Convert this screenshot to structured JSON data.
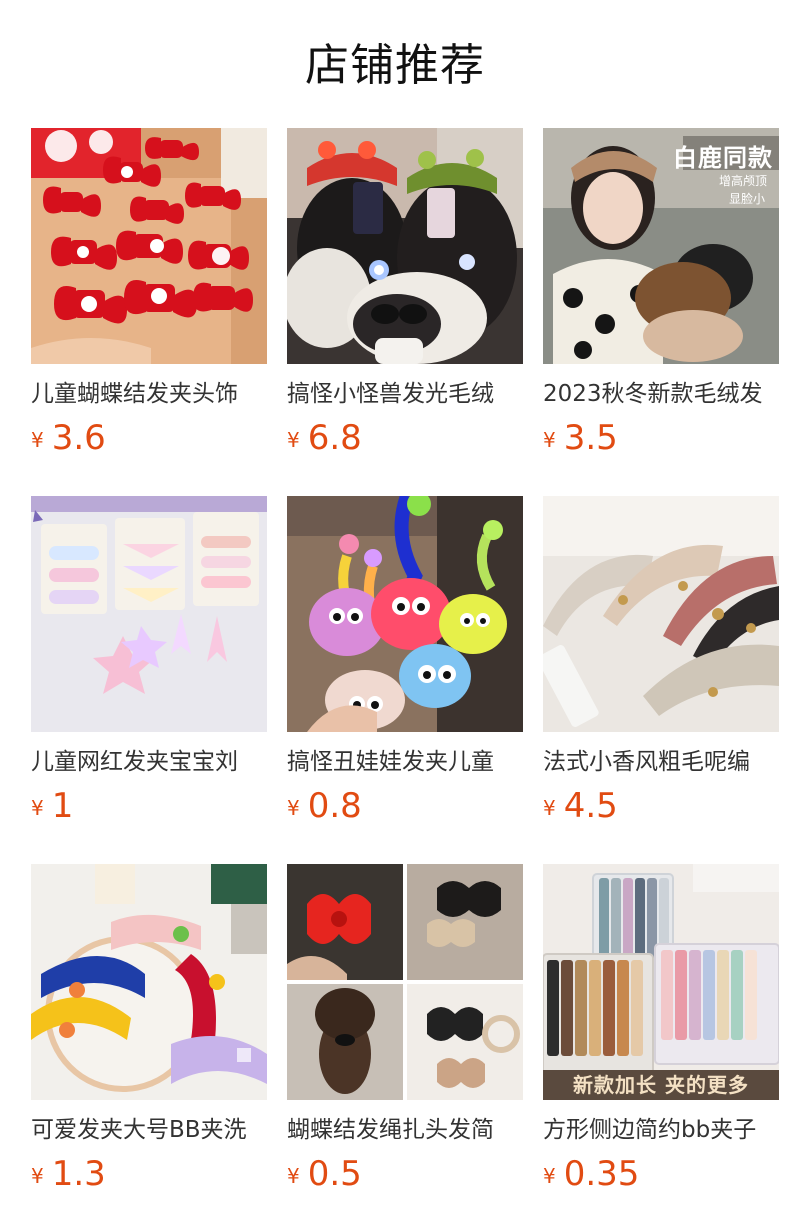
{
  "header": {
    "title": "店铺推荐"
  },
  "colors": {
    "price": "#e14b12",
    "text": "#333333",
    "title": "#111111"
  },
  "products": [
    {
      "name": "儿童蝴蝶结发夹头饰",
      "currency": "¥",
      "price": "3.6",
      "image": "red-bow-clips-photo"
    },
    {
      "name": "搞怪小怪兽发光毛绒",
      "currency": "¥",
      "price": "6.8",
      "image": "glowing-monster-headband-photo"
    },
    {
      "name": "2023秋冬新款毛绒发",
      "currency": "¥",
      "price": "3.5",
      "image": "plush-headband-photo",
      "overlay_title": "白鹿同款",
      "overlay_sub": [
        "增高颅顶",
        "显脸小"
      ]
    },
    {
      "name": "儿童网红发夹宝宝刘",
      "currency": "¥",
      "price": "1",
      "image": "pastel-hair-clips-photo"
    },
    {
      "name": "搞怪丑娃娃发夹儿童",
      "currency": "¥",
      "price": "0.8",
      "image": "fuzzy-doll-clips-photo"
    },
    {
      "name": "法式小香风粗毛呢编",
      "currency": "¥",
      "price": "4.5",
      "image": "tweed-headbands-photo"
    },
    {
      "name": "可爱发夹大号BB夹洗",
      "currency": "¥",
      "price": "1.3",
      "image": "padded-bb-clips-photo"
    },
    {
      "name": "蝴蝶结发绳扎头发简",
      "currency": "¥",
      "price": "0.5",
      "image": "bow-scrunchies-photo"
    },
    {
      "name": "方形侧边简约bb夹子",
      "currency": "¥",
      "price": "0.35",
      "image": "matte-bb-clips-photo",
      "overlay_banner": "新款加长 夹的更多"
    }
  ]
}
